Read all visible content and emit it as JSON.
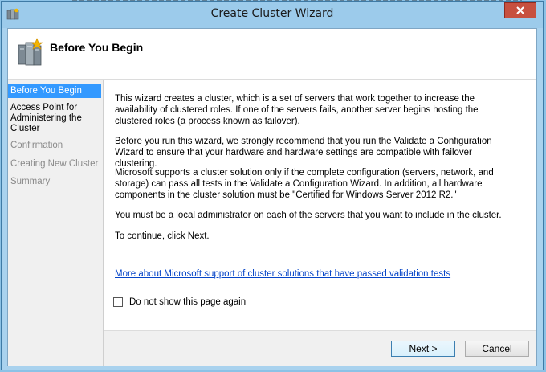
{
  "window": {
    "title": "Create Cluster Wizard"
  },
  "header": {
    "title": "Before You Begin"
  },
  "steps": [
    {
      "label": "Before You Begin",
      "state": "active"
    },
    {
      "label": "Access Point for Administering the Cluster",
      "state": "normal"
    },
    {
      "label": "Confirmation",
      "state": "disabled"
    },
    {
      "label": "Creating New Cluster",
      "state": "disabled"
    },
    {
      "label": "Summary",
      "state": "disabled"
    }
  ],
  "content": {
    "paragraphs": [
      "This wizard creates a cluster, which is a set of servers that work together to increase the availability of clustered roles. If one of the servers fails, another server begins hosting the clustered roles (a process known as failover).",
      "Before you run this wizard, we strongly recommend that you run the Validate a Configuration Wizard to ensure that your hardware and hardware settings are compatible with failover clustering.",
      "Microsoft supports a cluster solution only if the complete configuration (servers, network, and storage) can pass all tests in the Validate a Configuration Wizard. In addition, all hardware components in the cluster solution must be \"Certified for Windows Server 2012 R2.\"",
      "You must be a local administrator on each of the servers that you want to include in the cluster.",
      "To continue, click Next."
    ],
    "link": "More about Microsoft support of cluster solutions that have passed validation tests",
    "checkbox_label": "Do not show this page again",
    "checkbox_checked": false
  },
  "buttons": {
    "next": "Next >",
    "cancel": "Cancel"
  },
  "icons": {
    "app": "cluster-app-icon",
    "close": "close-icon",
    "header": "servers-icon"
  }
}
